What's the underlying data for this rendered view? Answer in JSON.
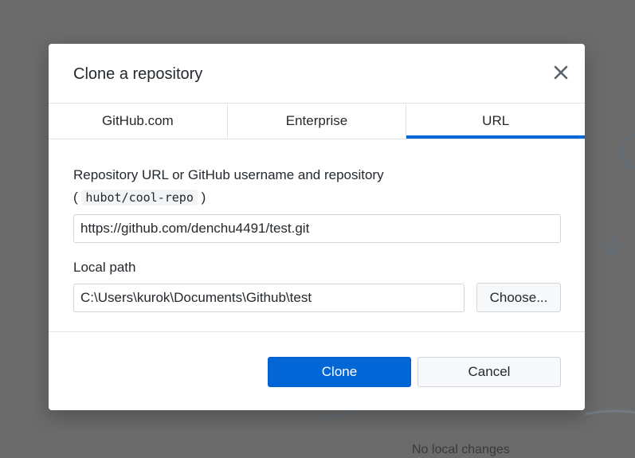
{
  "background": {
    "status_text": "No local changes"
  },
  "dialog": {
    "title": "Clone a repository",
    "tabs": [
      {
        "label": "GitHub.com",
        "selected": false
      },
      {
        "label": "Enterprise",
        "selected": false
      },
      {
        "label": "URL",
        "selected": true
      }
    ],
    "url_field": {
      "label": "Repository URL or GitHub username and repository",
      "hint_open": "(",
      "hint_code": "hubot/cool-repo",
      "hint_close": ")",
      "value": "https://github.com/denchu4491/test.git"
    },
    "local_path": {
      "label": "Local path",
      "value": "C:\\Users\\kurok\\Documents\\Github\\test",
      "choose_label": "Choose..."
    },
    "buttons": {
      "clone": "Clone",
      "cancel": "Cancel"
    }
  },
  "colors": {
    "accent": "#0366d6",
    "overlay": "#6b6b6b"
  },
  "icons": {
    "close": "close-icon"
  }
}
